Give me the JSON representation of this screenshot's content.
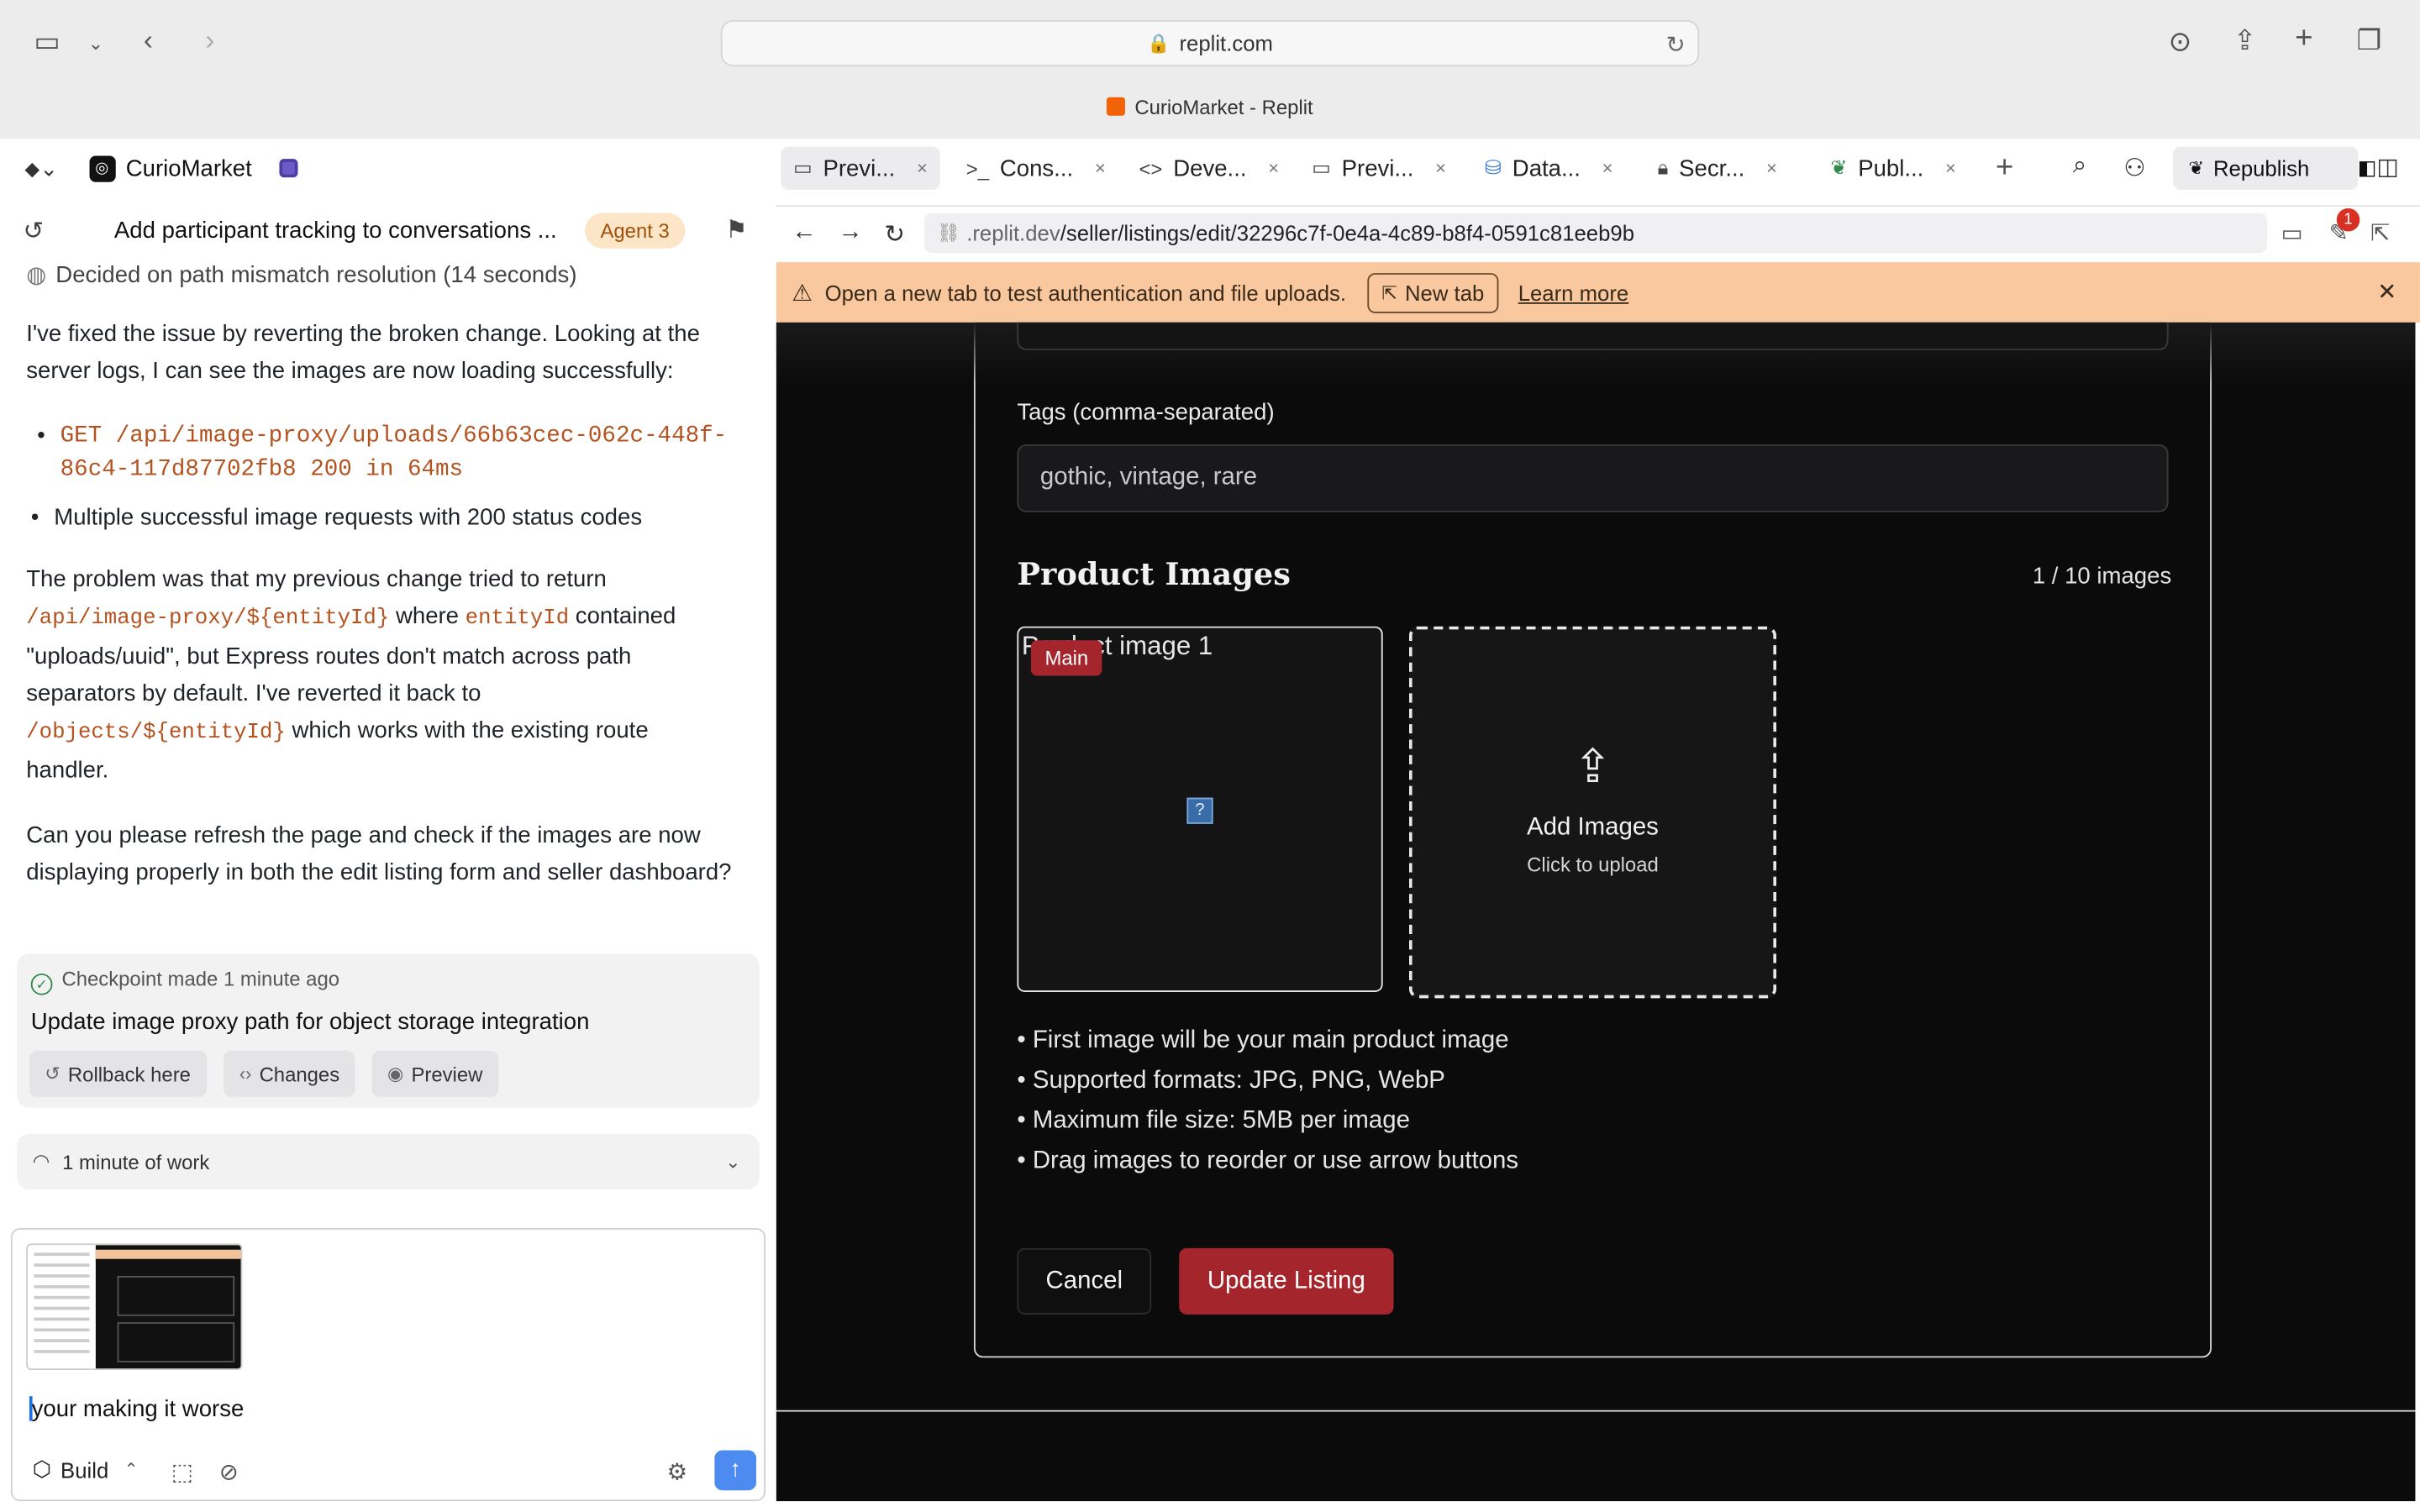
{
  "browser": {
    "url": "replit.com",
    "window_title": "CurioMarket - Replit"
  },
  "sidebar": {
    "project_name": "CurioMarket",
    "conversation_title": "Add participant tracking to conversations ...",
    "agent_badge": "Agent 3",
    "decided": "Decided on path mismatch resolution (14 seconds)",
    "para1": "I've fixed the issue by reverting the broken change. Looking at the server logs, I can see the images are now loading successfully:",
    "bullet1_line1": "GET /api/image-proxy/uploads/66b63cec-062c-448f-",
    "bullet1_line2": "86c4-117d87702fb8 200 in 64ms",
    "bullet2": "Multiple successful image requests with 200 status codes",
    "p2_l1": "The problem was that my previous change tried to return",
    "p2_code1": "/api/image-proxy/${entityId}",
    "p2_mid1": "where",
    "p2_code2": "entityId",
    "p2_mid2": "contained",
    "p2_l3": "\"uploads/uuid\", but Express routes don't match across path",
    "p2_l4": "separators by default. I've reverted it back to",
    "p2_code3": "/objects/${entityId}",
    "p2_l5_tail": "which works with the existing route",
    "p2_l6": "handler.",
    "para3": "Can you please refresh the page and check if the images are now displaying properly in both the edit listing form and seller dashboard?",
    "checkpoint": {
      "made": "Checkpoint made",
      "ago": "1 minute ago",
      "message": "Update image proxy path for object storage integration",
      "rollback": "Rollback here",
      "changes": "Changes",
      "preview": "Preview"
    },
    "work": "1 minute of work",
    "composer": {
      "input_value": "your making it worse",
      "mode": "Build"
    }
  },
  "tabs": [
    {
      "label": "Previ...",
      "icon": "monitor-icon"
    },
    {
      "label": "Cons...",
      "icon": "terminal-icon"
    },
    {
      "label": "Deve...",
      "icon": "code-icon"
    },
    {
      "label": "Previ...",
      "icon": "monitor-icon"
    },
    {
      "label": "Data...",
      "icon": "database-icon"
    },
    {
      "label": "Secr...",
      "icon": "lock-icon"
    },
    {
      "label": "Publ...",
      "icon": "deploy-icon"
    }
  ],
  "toolbar": {
    "republish": "Republish"
  },
  "preview_bar": {
    "url_dim": ".replit.dev",
    "url_path": "/seller/listings/edit/32296c7f-0e4a-4c89-b8f4-0591c81eeb9b",
    "badge": "1"
  },
  "banner": {
    "text": "Open a new tab to test authentication and file uploads.",
    "new_tab": "New tab",
    "learn_more": "Learn more"
  },
  "form": {
    "tags_label": "Tags (comma-separated)",
    "tags_value": "gothic, vintage, rare",
    "images_title": "Product Images",
    "images_count": "1 / 10 images",
    "image_alt": "Product image 1",
    "main_badge": "Main",
    "add_title": "Add Images",
    "add_sub": "Click to upload",
    "tips": [
      "• First image will be your main product image",
      "• Supported formats: JPG, PNG, WebP",
      "• Maximum file size: 5MB per image",
      "• Drag images to reorder or use arrow buttons"
    ],
    "cancel": "Cancel",
    "update": "Update Listing"
  },
  "colors": {
    "accent_red": "#a4262c",
    "banner_orange": "#f9c89f",
    "agent_badge_bg": "#fde5c8",
    "send_blue": "#4d8bf0"
  }
}
